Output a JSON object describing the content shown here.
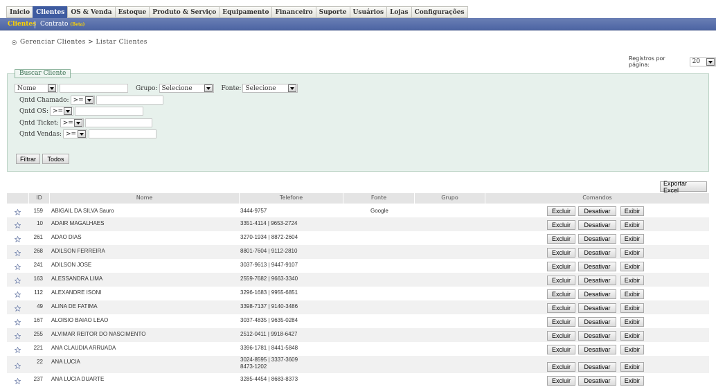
{
  "top_menu": [
    "Inicio",
    "Clientes",
    "OS & Venda",
    "Estoque",
    "Produto & Serviço",
    "Equipamento",
    "Financeiro",
    "Suporte",
    "Usuários",
    "Lojas",
    "Configurações"
  ],
  "sub_menu": {
    "clientes": "Clientes",
    "contrato": "Contrato",
    "beta": "(Beta)"
  },
  "breadcrumb": "Gerenciar Clientes > Listar Clientes",
  "per_page": {
    "label": "Registros por página:",
    "value": "20"
  },
  "search": {
    "legend": "Buscar Cliente",
    "field_select": "Nome",
    "grupo_label": "Grupo:",
    "grupo_value": "Selecione",
    "fonte_label": "Fonte:",
    "fonte_value": "Selecione",
    "qntd_chamado_label": "Qntd Chamado:",
    "qntd_os_label": "Qntd OS:",
    "qntd_ticket_label": "Qntd Ticket:",
    "qntd_vendas_label": "Qntd Vendas:",
    "operator": ">=",
    "filter_button": "Filtrar",
    "all_button": "Todos"
  },
  "export_button": "Exportar Excel",
  "table": {
    "headers": {
      "id": "ID",
      "name": "Nome",
      "phone": "Telefone",
      "source": "Fonte",
      "group": "Grupo",
      "commands": "Comandos"
    },
    "command_labels": {
      "delete": "Excluir",
      "deactivate": "Desativar",
      "view": "Exibir"
    },
    "rows": [
      {
        "id": "159",
        "name": "ABIGAIL DA SILVA Sauro",
        "phone": "3444-9757",
        "phone2": "",
        "source": "Google"
      },
      {
        "id": "10",
        "name": "ADAIR MAGALHAES",
        "phone": "3351-4114 | 9653-2724",
        "phone2": "",
        "source": ""
      },
      {
        "id": "261",
        "name": "ADAO DIAS",
        "phone": "3270-1934 | 8872-2604",
        "phone2": "",
        "source": ""
      },
      {
        "id": "268",
        "name": "ADILSON FERREIRA",
        "phone": "8801-7604 | 9112-2810",
        "phone2": "",
        "source": ""
      },
      {
        "id": "241",
        "name": "ADILSON JOSE",
        "phone": "3037-9613 | 9447-9107",
        "phone2": "",
        "source": ""
      },
      {
        "id": "163",
        "name": "ALESSANDRA LIMA",
        "phone": "2559-7682 | 9663-3340",
        "phone2": "",
        "source": ""
      },
      {
        "id": "112",
        "name": "ALEXANDRE ISONI",
        "phone": "3296-1683 | 9955-6851",
        "phone2": "",
        "source": ""
      },
      {
        "id": "49",
        "name": "ALINA DE FATIMA",
        "phone": "3398-7137 | 9140-3486",
        "phone2": "",
        "source": ""
      },
      {
        "id": "167",
        "name": "ALOISIO BAIAO LEAO",
        "phone": "3037-4835 | 9635-0284",
        "phone2": "",
        "source": ""
      },
      {
        "id": "255",
        "name": "ALVIMAR REITOR DO NASCIMENTO",
        "phone": "2512-0411 | 9918-6427",
        "phone2": "",
        "source": ""
      },
      {
        "id": "221",
        "name": "ANA CLAUDIA ARRUADA",
        "phone": "3396-1781 | 8441-5848",
        "phone2": "",
        "source": ""
      },
      {
        "id": "22",
        "name": "ANA LUCIA",
        "phone": "3024-8595 | 3337-3609",
        "phone2": "8473-1202",
        "source": ""
      },
      {
        "id": "237",
        "name": "ANA LUCIA DUARTE",
        "phone": "3285-4454 | 8683-8373",
        "phone2": "",
        "source": ""
      }
    ]
  }
}
